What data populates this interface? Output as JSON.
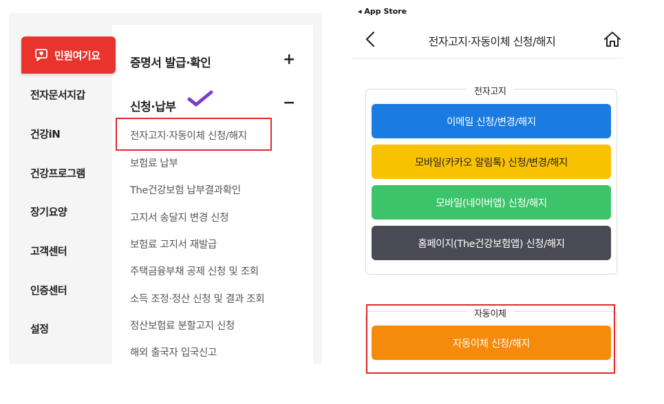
{
  "left": {
    "complaint_tab_label": "민원여기요",
    "nav_items": [
      "전자문서지갑",
      "건강iN",
      "건강프로그램",
      "장기요양",
      "고객센터",
      "인증센터",
      "설정"
    ],
    "section1": {
      "title": "증명서 발급·확인",
      "toggle": "+"
    },
    "section2": {
      "title": "신청·납부",
      "toggle": "−"
    },
    "menu_items": [
      "전자고지·자동이체 신청/해지",
      "보험료 납부",
      "The건강보험 납부결과확인",
      "고지서 송달지 변경 신청",
      "보험료 고지서 재발급",
      "주택금융부채 공제 신청 및 조회",
      "소득 조정·정산 신청 및 결과 조회",
      "정산보험료 분할고지 신청",
      "해외 출국자 입국신고"
    ]
  },
  "right": {
    "status_bar": "◂ App Store",
    "page_title": "전자고지·자동이체 신청/해지",
    "group1": {
      "label": "전자고지",
      "buttons": [
        {
          "label": "이메일 신청/변경/해지",
          "color": "#1a7be0",
          "text_color": "#ffffff"
        },
        {
          "label": "모바일(카카오 알림톡) 신청/변경/해지",
          "color": "#f9c200",
          "text_color": "#222222"
        },
        {
          "label": "모바일(네이버앱) 신청/해지",
          "color": "#3dc46a",
          "text_color": "#ffffff"
        },
        {
          "label": "홈페이지(The건강보험앱) 신청/해지",
          "color": "#4a4a55",
          "text_color": "#ffffff"
        }
      ]
    },
    "group2": {
      "label": "자동이체",
      "buttons": [
        {
          "label": "자동이체 신청/해지",
          "color": "#f58a0b",
          "text_color": "#ffffff"
        }
      ]
    }
  },
  "colors": {
    "accent_red": "#e9342e",
    "highlight_red": "#e3262b",
    "check_purple": "#7b3fd0"
  }
}
